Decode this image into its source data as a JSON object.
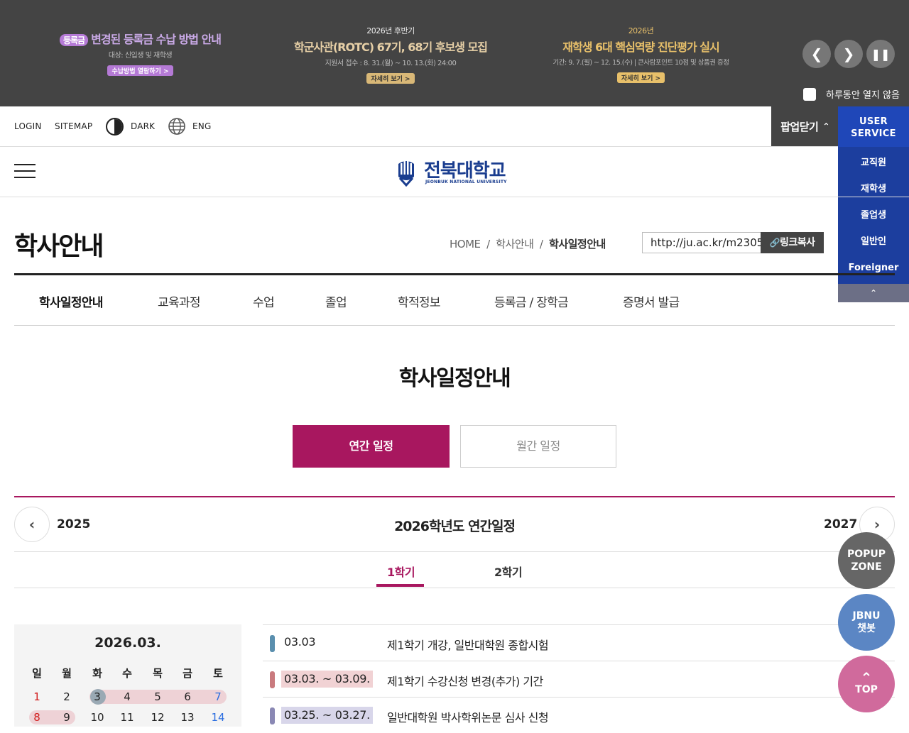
{
  "popup": {
    "b1": {
      "tag": "등록금",
      "title": "변경된 등록금 수납 방법 안내",
      "sub": "대상: 신입생 및 재학생",
      "btn": "수납방법 열람하기 >"
    },
    "b2": {
      "small": "2026년 후반기",
      "title": "학군사관(ROTC) 67기, 68기 후보생 모집",
      "sub": "지원서 접수 : 8. 31.(월) ~ 10. 13.(화) 24:00",
      "btn": "자세히 보기 >"
    },
    "b3": {
      "small": "2026년",
      "title": "재학생 6대 핵심역량 진단평가 실시",
      "sub": "기간: 9. 7.(월) ~ 12. 15.(수) | 큰사람포인트 10점 및 상품권 증정",
      "btn": "자세히 보기 >"
    },
    "no_show_today": "하루동안 열지 않음",
    "close_label": "팝업닫기"
  },
  "util": {
    "login": "LOGIN",
    "sitemap": "SITEMAP",
    "dark": "DARK",
    "eng": "ENG"
  },
  "user_service": {
    "title1": "USER",
    "title2": "SERVICE",
    "items": [
      "교직원",
      "재학생",
      "졸업생",
      "일반인",
      "Foreigner"
    ]
  },
  "logo": {
    "kr": "전북대학교",
    "en": "JEONBUK NATIONAL UNIVERSITY"
  },
  "page": {
    "title": "학사안내",
    "breadcrumb": {
      "home": "HOME",
      "sep": "/",
      "l1": "학사안내",
      "l2": "학사일정안내"
    },
    "url": "http://ju.ac.kr/m2305",
    "copy": "링크복사"
  },
  "tabs": [
    "학사일정안내",
    "교육과정",
    "수업",
    "졸업",
    "학적정보",
    "등록금 / 장학금",
    "증명서 발급"
  ],
  "section": {
    "title": "학사일정안내",
    "btn_year": "연간 일정",
    "btn_month": "월간 일정"
  },
  "year": {
    "prev": "2025",
    "title": "2026학년도 연간일정",
    "next": "2027"
  },
  "semesters": [
    "1학기",
    "2학기"
  ],
  "calendar": {
    "month": "2026.03.",
    "weekdays": [
      "일",
      "월",
      "화",
      "수",
      "목",
      "금",
      "토"
    ],
    "week1": [
      "1",
      "2",
      "3",
      "4",
      "5",
      "6",
      "7"
    ],
    "week2": [
      "8",
      "9",
      "10",
      "11",
      "12",
      "13",
      "14"
    ]
  },
  "events": [
    {
      "date": "03.03",
      "text": "제1학기 개강, 일반대학원 종합시험",
      "color": "#5a8fae"
    },
    {
      "date": "03.03. ~ 03.09.",
      "text": "제1학기 수강신청 변경(추가) 기간",
      "color": "#c97a7e",
      "bg": "#f1d2d4"
    },
    {
      "date": "03.25. ~ 03.27.",
      "text": "일반대학원 박사학위논문 심사 신청",
      "color": "#8a88b4",
      "bg": "#d8d6ea"
    }
  ],
  "floating": {
    "popup1": "POPUP",
    "popup2": "ZONE",
    "chat1": "JBNU",
    "chat2": "챗봇",
    "top": "TOP"
  }
}
